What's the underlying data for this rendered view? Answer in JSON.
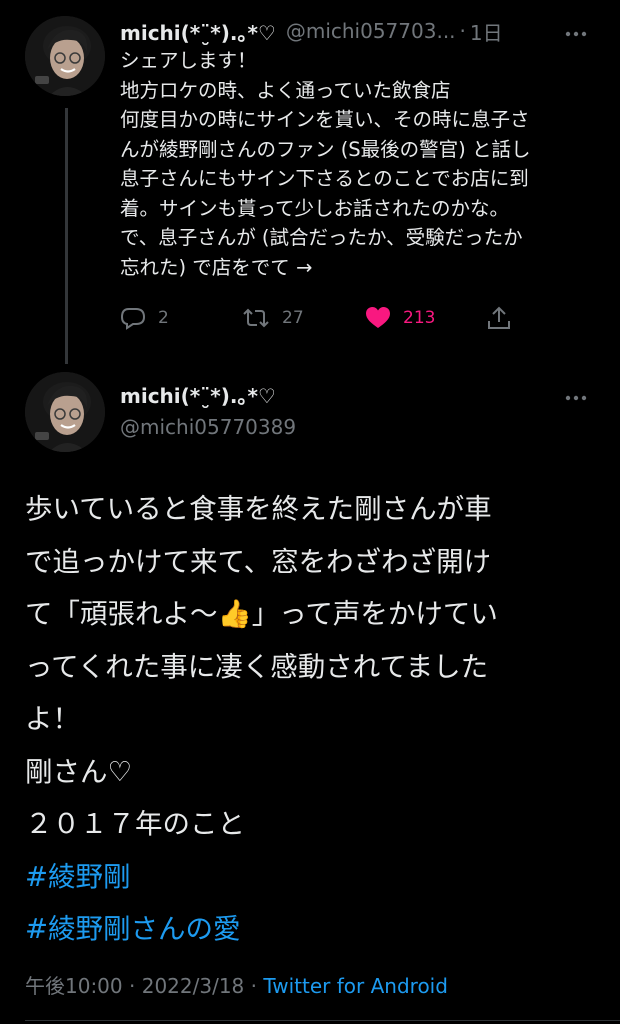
{
  "reply_tweet": {
    "display_name": "michi(*¨̮*).｡*♡",
    "handle": "@michi057703...",
    "separator": "·",
    "time": "1日",
    "text_lines": [
      "シェアします！",
      "地方ロケの時、よく通っていた飲食店",
      "何度目かの時にサインを貰い、その時に息子さ",
      "んが綾野剛さんのファン (S最後の警官) と話し",
      "息子さんにもサイン下さるとのことでお店に到",
      "着。サインも貰って少しお話されたのかな。",
      "で、息子さんが (試合だったか、受験だったか",
      "忘れた) で店をでて →"
    ],
    "actions": {
      "replies": "2",
      "retweets": "27",
      "likes": "213"
    }
  },
  "main_tweet": {
    "display_name": "michi(*¨̮*).｡*♡",
    "handle": "@michi05770389",
    "text_lines": [
      "歩いていると食事を終えた剛さんが車",
      "で追っかけて来て、窓をわざわざ開け",
      "て「頑張れよ〜👍」って声をかけてい",
      "ってくれた事に凄く感動されてました",
      "よ！",
      "剛さん♡",
      "２０１７年のこと"
    ],
    "hashtags": [
      "#綾野剛",
      "#綾野剛さんの愛"
    ],
    "meta": {
      "time": "午後10:00",
      "sep1": " · ",
      "date": "2022/3/18",
      "sep2": " · ",
      "source": "Twitter for Android"
    }
  },
  "colors": {
    "background": "#000000",
    "text": "#e7e9ea",
    "muted": "#71767b",
    "link": "#1d9bf0",
    "like": "#f91880",
    "thread_line": "#333639"
  },
  "icons": [
    "more-icon",
    "reply-icon",
    "retweet-icon",
    "heart-icon",
    "share-icon"
  ]
}
